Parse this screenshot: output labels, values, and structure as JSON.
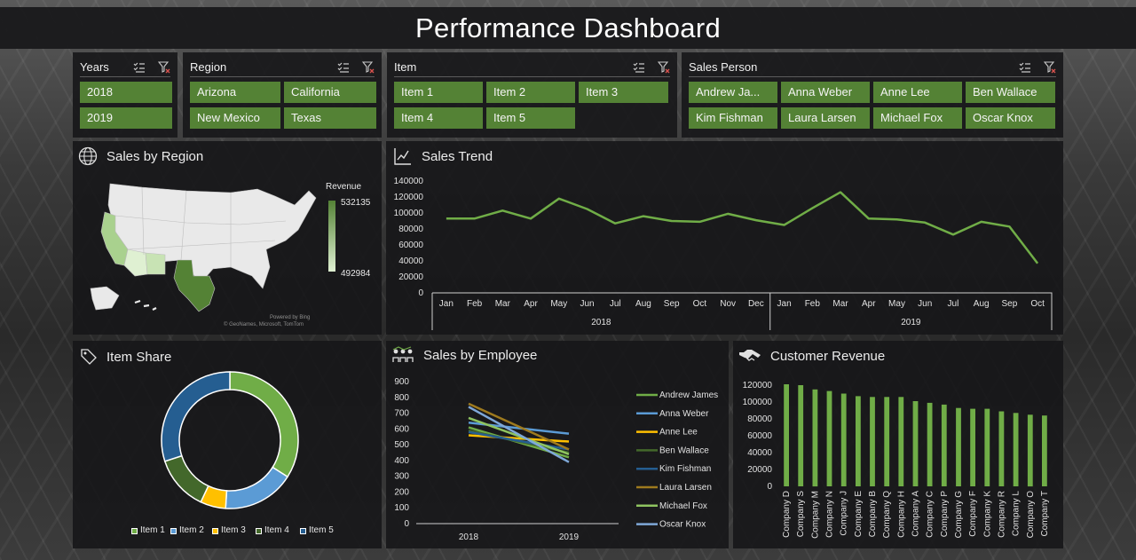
{
  "header": {
    "title": "Performance Dashboard"
  },
  "slicers": {
    "years": {
      "label": "Years",
      "items": [
        "2018",
        "2019"
      ]
    },
    "region": {
      "label": "Region",
      "items": [
        "Arizona",
        "California",
        "New Mexico",
        "Texas"
      ]
    },
    "item": {
      "label": "Item",
      "items": [
        "Item 1",
        "Item 2",
        "Item 3",
        "Item 4",
        "Item 5"
      ]
    },
    "sales_person": {
      "label": "Sales Person",
      "items": [
        "Andrew Ja...",
        "Anna Weber",
        "Anne Lee",
        "Ben Wallace",
        "Kim Fishman",
        "Laura Larsen",
        "Michael Fox",
        "Oscar Knox"
      ]
    },
    "icons": {
      "multiselect": "multi-select-icon",
      "clear_filter": "clear-filter-icon"
    }
  },
  "sales_by_region": {
    "title": "Sales by Region",
    "icon": "globe-icon",
    "legend_title": "Revenue",
    "legend_max": "532135",
    "legend_min": "492984",
    "credit_line1": "Powered by Bing",
    "credit_line2": "© GeoNames, Microsoft, TomTom",
    "colors": {
      "land": "#e9e9e9",
      "light": "#c8e3b4",
      "mid": "#a9d18e",
      "dark": "#548235"
    }
  },
  "sales_trend": {
    "title": "Sales Trend",
    "icon": "line-chart-icon",
    "color": "#70ad47"
  },
  "item_share": {
    "title": "Item Share",
    "icon": "tag-icon"
  },
  "sales_by_employee": {
    "title": "Sales by Employee",
    "icon": "people-chart-icon"
  },
  "customer_revenue": {
    "title": "Customer Revenue",
    "icon": "handshake-icon",
    "color": "#70ad47"
  },
  "chart_data": [
    {
      "id": "sales_trend",
      "type": "line",
      "title": "Sales Trend",
      "x": [
        "Jan",
        "Feb",
        "Mar",
        "Apr",
        "May",
        "Jun",
        "Jul",
        "Aug",
        "Sep",
        "Oct",
        "Nov",
        "Dec",
        "Jan",
        "Feb",
        "Mar",
        "Apr",
        "May",
        "Jun",
        "Jul",
        "Aug",
        "Sep",
        "Oct"
      ],
      "x_groups": [
        {
          "label": "2018",
          "count": 12
        },
        {
          "label": "2019",
          "count": 10
        }
      ],
      "values": [
        93000,
        93000,
        103000,
        93000,
        118000,
        105000,
        87000,
        96000,
        90000,
        89000,
        99000,
        91000,
        85000,
        106000,
        126000,
        93000,
        92000,
        88000,
        73000,
        89000,
        83000,
        37000
      ],
      "yticks": [
        0,
        20000,
        40000,
        60000,
        80000,
        100000,
        120000,
        140000
      ],
      "ylim": [
        0,
        140000
      ],
      "grid": false
    },
    {
      "id": "item_share",
      "type": "pie",
      "title": "Item Share",
      "donut": true,
      "categories": [
        "Item 1",
        "Item 2",
        "Item 3",
        "Item 4",
        "Item 5"
      ],
      "values": [
        34,
        17,
        6,
        13,
        30
      ],
      "colors": [
        "#70ad47",
        "#5b9bd5",
        "#ffc000",
        "#43682b",
        "#255e91"
      ],
      "legend": "bottom"
    },
    {
      "id": "sales_by_employee",
      "type": "line",
      "title": "Sales by Employee",
      "categories": [
        "2018",
        "2019"
      ],
      "yticks": [
        0,
        100,
        200,
        300,
        400,
        500,
        600,
        700,
        800,
        900
      ],
      "ylim": [
        0,
        900
      ],
      "legend": "right",
      "series": [
        {
          "name": "Andrew James",
          "values": [
            610,
            420
          ],
          "color": "#70ad47"
        },
        {
          "name": "Anna Weber",
          "values": [
            640,
            570
          ],
          "color": "#5b9bd5"
        },
        {
          "name": "Anne Lee",
          "values": [
            560,
            520
          ],
          "color": "#ffc000"
        },
        {
          "name": "Ben Wallace",
          "values": [
            590,
            450
          ],
          "color": "#43682b"
        },
        {
          "name": "Kim Fishman",
          "values": [
            580,
            470
          ],
          "color": "#255e91"
        },
        {
          "name": "Laura Larsen",
          "values": [
            760,
            470
          ],
          "color": "#9e7a1e"
        },
        {
          "name": "Michael Fox",
          "values": [
            670,
            440
          ],
          "color": "#8fc460"
        },
        {
          "name": "Oscar Knox",
          "values": [
            740,
            390
          ],
          "color": "#7fa8d8"
        }
      ]
    },
    {
      "id": "customer_revenue",
      "type": "bar",
      "title": "Customer Revenue",
      "categories": [
        "Company D",
        "Company S",
        "Company M",
        "Company N",
        "Company J",
        "Company E",
        "Company B",
        "Company Q",
        "Company H",
        "Company A",
        "Company C",
        "Company P",
        "Company G",
        "Company F",
        "Company K",
        "Company R",
        "Company L",
        "Company O",
        "Company T"
      ],
      "values": [
        121000,
        120000,
        115000,
        113000,
        110000,
        107000,
        106000,
        106000,
        106000,
        101000,
        99000,
        97000,
        93000,
        92000,
        92000,
        89000,
        87000,
        85000,
        84000
      ],
      "yticks": [
        0,
        20000,
        40000,
        60000,
        80000,
        100000,
        120000
      ],
      "ylim": [
        0,
        140000
      ],
      "grid": false
    }
  ]
}
